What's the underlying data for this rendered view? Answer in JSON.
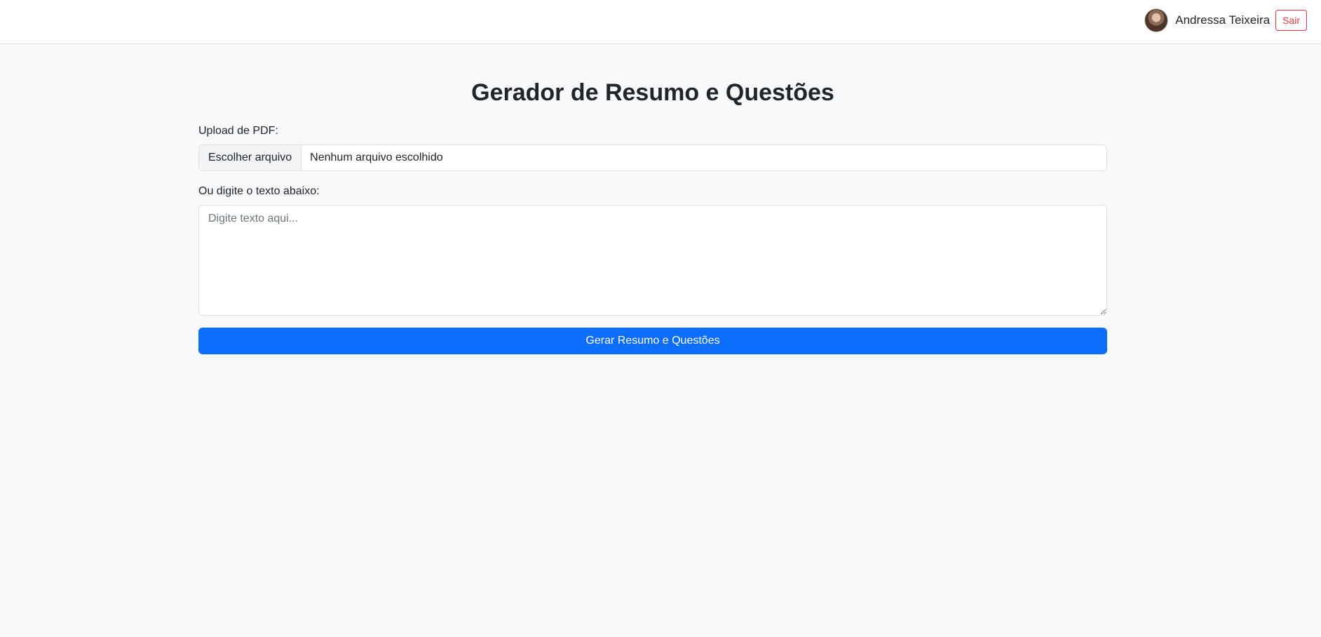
{
  "header": {
    "user_name": "Andressa Teixeira",
    "logout_label": "Sair"
  },
  "main": {
    "title": "Gerador de Resumo e Questões",
    "upload_label": "Upload de PDF:",
    "file_button_label": "Escolher arquivo",
    "file_status": "Nenhum arquivo escolhido",
    "text_label": "Ou digite o texto abaixo:",
    "text_placeholder": "Digite texto aqui...",
    "text_value": "",
    "submit_label": "Gerar Resumo e Questões"
  },
  "colors": {
    "primary": "#0d6efd",
    "danger": "#dc3545",
    "background": "#f8f9fa"
  }
}
